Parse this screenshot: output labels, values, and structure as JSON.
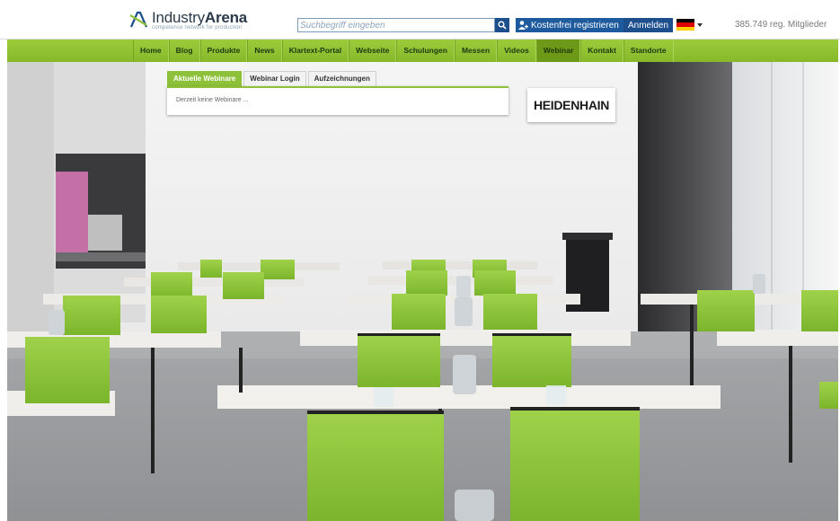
{
  "header": {
    "logo_name_light": "Industry",
    "logo_name_bold": "Arena",
    "logo_tagline": "competence network for production",
    "search_placeholder": "Suchbegriff eingeben",
    "register_label": "Kostenfrei registrieren",
    "login_label": "Anmelden",
    "members_text": "385.749 reg. Mitglieder",
    "language_flag_colors": [
      "#000000",
      "#dd0000",
      "#ffce00"
    ]
  },
  "nav": {
    "items": [
      {
        "label": "Home"
      },
      {
        "label": "Blog"
      },
      {
        "label": "Produkte"
      },
      {
        "label": "News"
      },
      {
        "label": "Klartext-Portal"
      },
      {
        "label": "Webseite"
      },
      {
        "label": "Schulungen"
      },
      {
        "label": "Messen"
      },
      {
        "label": "Videos"
      },
      {
        "label": "Webinar"
      },
      {
        "label": "Kontakt"
      },
      {
        "label": "Standorte"
      }
    ],
    "active_index": 9
  },
  "webinar": {
    "tabs": [
      {
        "label": "Aktuelle Webinare"
      },
      {
        "label": "Webinar Login"
      },
      {
        "label": "Aufzeichnungen"
      }
    ],
    "active_tab": 0,
    "empty_message": "Derzeit keine Webinare ..."
  },
  "brand_logo": "HEIDENHAIN",
  "colors": {
    "accent_green": "#8dc13a",
    "nav_green": "#9ccc3c",
    "button_blue": "#1d5a9e",
    "chair_green": "#8cc63f"
  }
}
